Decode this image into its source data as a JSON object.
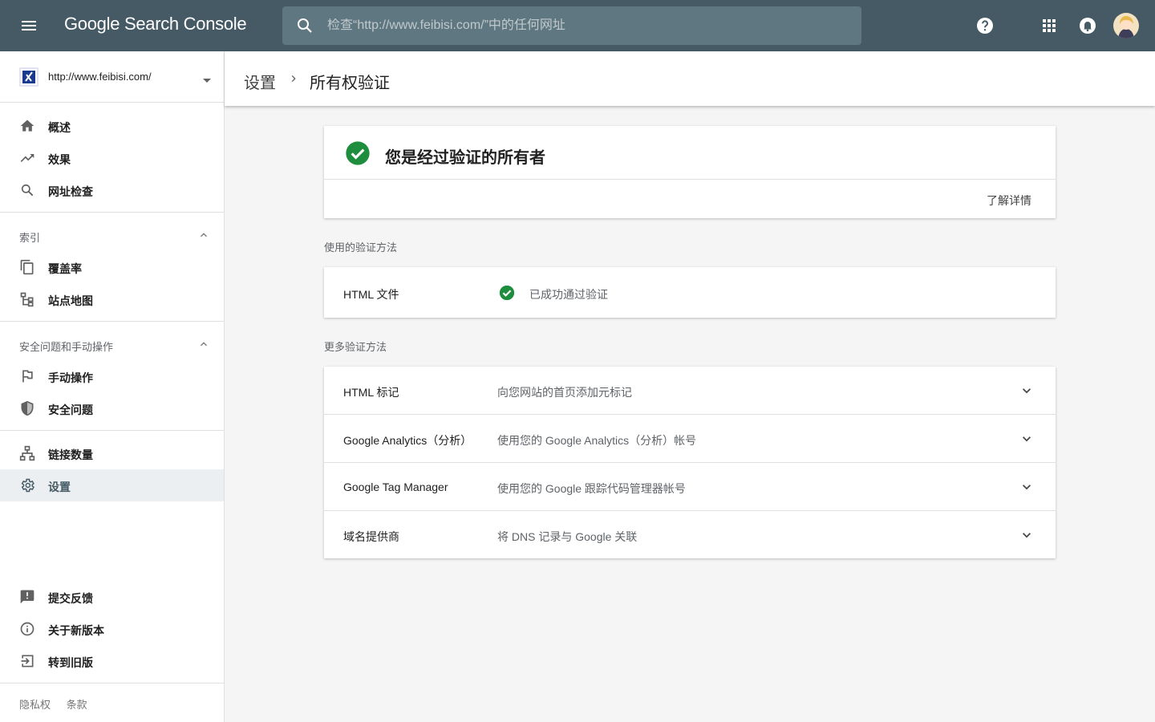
{
  "app": {
    "title": "Google Search Console"
  },
  "search": {
    "placeholder": "检查“http://www.feibisi.com/”中的任何网址"
  },
  "property": {
    "url": "http://www.feibisi.com/"
  },
  "sidebar": {
    "main": [
      {
        "label": "概述",
        "icon": "home-icon"
      },
      {
        "label": "效果",
        "icon": "trending-up-icon"
      },
      {
        "label": "网址检查",
        "icon": "search-icon"
      }
    ],
    "index_section": {
      "label": "索引"
    },
    "index_items": [
      {
        "label": "覆盖率",
        "icon": "copy-icon"
      },
      {
        "label": "站点地图",
        "icon": "sitemap-icon"
      }
    ],
    "security_section": {
      "label": "安全问题和手动操作"
    },
    "security_items": [
      {
        "label": "手动操作",
        "icon": "flag-icon"
      },
      {
        "label": "安全问题",
        "icon": "shield-icon"
      }
    ],
    "other_items": [
      {
        "label": "链接数量",
        "icon": "links-icon"
      },
      {
        "label": "设置",
        "icon": "gear-icon",
        "active": true
      }
    ],
    "bottom_items": [
      {
        "label": "提交反馈",
        "icon": "feedback-icon"
      },
      {
        "label": "关于新版本",
        "icon": "info-icon"
      },
      {
        "label": "转到旧版",
        "icon": "exit-icon"
      }
    ],
    "footer": {
      "privacy": "隐私权",
      "terms": "条款"
    }
  },
  "breadcrumb": {
    "parent": "设置",
    "current": "所有权验证"
  },
  "owner": {
    "title": "您是经过验证的所有者",
    "learn_more": "了解详情"
  },
  "used_methods": {
    "label": "使用的验证方法",
    "items": [
      {
        "name": "HTML 文件",
        "status": "已成功通过验证"
      }
    ]
  },
  "more_methods": {
    "label": "更多验证方法",
    "items": [
      {
        "name": "HTML 标记",
        "desc": "向您网站的首页添加元标记"
      },
      {
        "name": "Google Analytics（分析）",
        "desc": "使用您的 Google Analytics（分析）帐号"
      },
      {
        "name": "Google Tag Manager",
        "desc": "使用您的 Google 跟踪代码管理器帐号"
      },
      {
        "name": "域名提供商",
        "desc": "将 DNS 记录与 Google 关联"
      }
    ]
  },
  "colors": {
    "topbar": "#455a64",
    "success": "#1e8e3e",
    "active_bg": "#eceff1"
  }
}
